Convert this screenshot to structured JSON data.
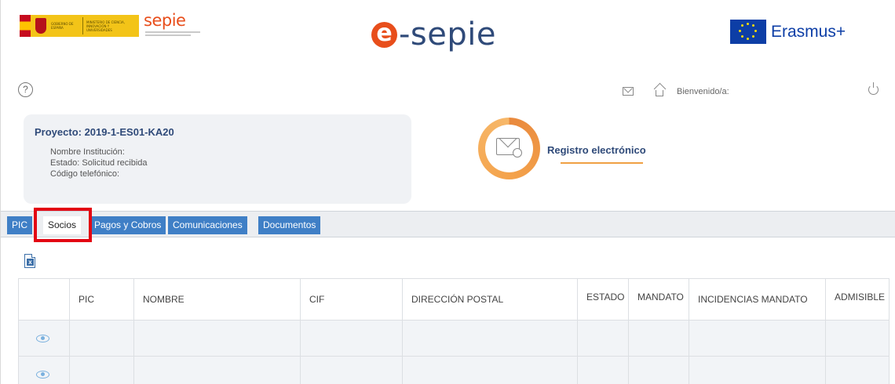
{
  "header": {
    "gov_logo_text": "GOBIERNO DE ESPAÑA",
    "ministry_text": "MINISTERIO DE CIENCIA, INNOVACIÓN Y UNIVERSIDADES",
    "sepie_small": "sepie",
    "brand_letter": "e",
    "brand_word": "-sepie",
    "eu_program": "Erasmus+"
  },
  "topbar": {
    "help_glyph": "?",
    "welcome": "Bienvenido/a:",
    "icons": [
      "mail-icon",
      "home-icon",
      "power-icon",
      "help-icon"
    ]
  },
  "project": {
    "title": "Proyecto: 2019-1-ES01-KA20",
    "institution": "Nombre Institución:",
    "status": "Estado:  Solicitud recibida",
    "phone": "Código telefónico:"
  },
  "registro": {
    "label": "Registro electrónico",
    "icon": "envelope-seal-icon"
  },
  "tabs": [
    {
      "label": "PIC",
      "active": false
    },
    {
      "label": "Socios",
      "active": true
    },
    {
      "label": "Pagos y Cobros",
      "active": false
    },
    {
      "label": "Comunicaciones",
      "active": false
    },
    {
      "label": "Documentos",
      "active": false
    }
  ],
  "toolbar": {
    "export_icon": "excel-icon",
    "export_glyph": "x"
  },
  "table": {
    "columns": [
      "",
      "PIC",
      "NOMBRE",
      "CIF",
      "DIRECCIÓN POSTAL",
      "ESTADO",
      "MANDATO",
      "INCIDENCIAS MANDATO",
      "ADMISIBLE"
    ],
    "rows": [
      {
        "action_icon": "eye-icon",
        "cells": [
          "",
          "",
          "",
          "",
          "",
          "",
          "",
          ""
        ]
      },
      {
        "action_icon": "eye-icon",
        "cells": [
          "",
          "",
          "",
          "",
          "",
          "",
          "",
          ""
        ]
      }
    ]
  },
  "colors": {
    "brand_orange": "#e84e1b",
    "brand_navy": "#2f4a79",
    "tab_blue": "#3f7fc6",
    "highlight_red": "#e30613",
    "registro_orange": "#f0a043"
  }
}
